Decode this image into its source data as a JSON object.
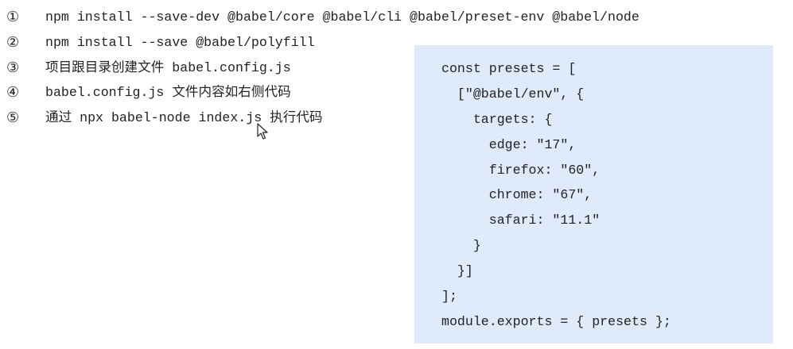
{
  "steps": [
    {
      "marker": "①",
      "text": "npm install --save-dev @babel/core @babel/cli @babel/preset-env @babel/node"
    },
    {
      "marker": "②",
      "text": "npm install --save @babel/polyfill"
    },
    {
      "marker": "③",
      "text": "项目跟目录创建文件 babel.config.js"
    },
    {
      "marker": "④",
      "text": "babel.config.js 文件内容如右侧代码"
    },
    {
      "marker": "⑤",
      "text": "通过 npx babel-node index.js 执行代码"
    }
  ],
  "code": {
    "lines": [
      "const presets = [",
      "  [\"@babel/env\", {",
      "    targets: {",
      "      edge: \"17\",",
      "      firefox: \"60\",",
      "      chrome: \"67\",",
      "      safari: \"11.1\"",
      "    }",
      "  }]",
      "];",
      "module.exports = { presets };"
    ]
  },
  "colors": {
    "code_background": "#dfeafb",
    "text": "#222222"
  }
}
